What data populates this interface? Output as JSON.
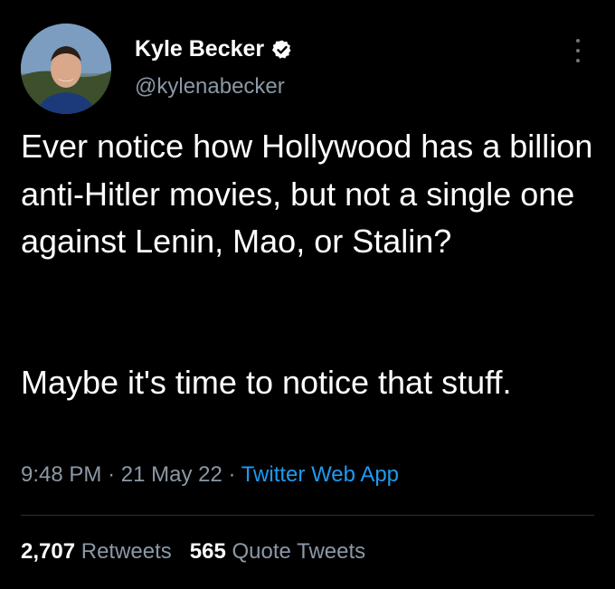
{
  "author": {
    "name": "Kyle Becker",
    "handle": "@kylenabecker",
    "verified": true,
    "avatar_icon": "profile-photo"
  },
  "tweet": {
    "paragraphs": [
      "Ever notice how Hollywood has a billion anti-Hitler movies, but not a single one against Lenin, Mao, or Stalin?",
      "Maybe it's time to notice that stuff."
    ],
    "time": "9:48 PM",
    "date": "21 May 22",
    "source": "Twitter Web App",
    "separator": "·"
  },
  "stats": {
    "retweets_count": "2,707",
    "retweets_label": "Retweets",
    "quotes_count": "565",
    "quotes_label": "Quote Tweets"
  },
  "icons": {
    "verified": "verified-badge-icon",
    "more": "more-options-icon"
  },
  "colors": {
    "background": "#000000",
    "text": "#ffffff",
    "muted": "#8b98a5",
    "link": "#1d9bf0",
    "divider": "#2f3336"
  }
}
